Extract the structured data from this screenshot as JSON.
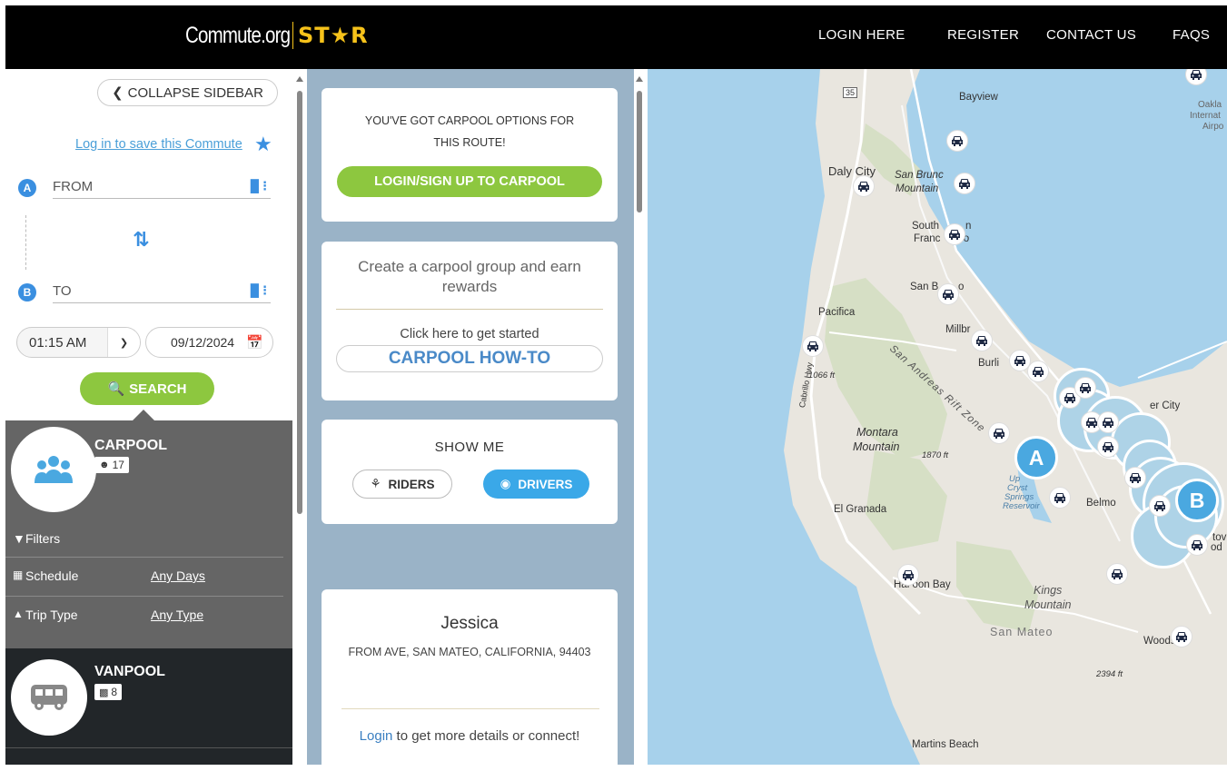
{
  "header": {
    "logo_text": "Commute.org",
    "logo_star": "ST★R",
    "nav": [
      "LOGIN HERE",
      "REGISTER",
      "CONTACT US",
      "FAQS"
    ]
  },
  "sidebar": {
    "collapse_label": "COLLAPSE SIDEBAR",
    "save_link": "Log in to save this Commute",
    "from_pin": "A",
    "to_pin": "B",
    "from_placeholder": "FROM",
    "to_placeholder": "TO",
    "time_value": "01:15 AM",
    "date_value": "09/12/2024",
    "search_label": "SEARCH",
    "carpool": {
      "title": "CARPOOL",
      "count": "17",
      "filters_label": "Filters",
      "schedule_label": "Schedule",
      "schedule_value": "Any Days",
      "trip_type_label": "Trip Type",
      "trip_type_value": "Any Type"
    },
    "vanpool": {
      "title": "VANPOOL",
      "count": "8"
    }
  },
  "middle": {
    "card1": {
      "text": "YOU'VE GOT CARPOOL OPTIONS FOR THIS ROUTE!",
      "button": "LOGIN/SIGN UP TO CARPOOL"
    },
    "card2": {
      "title": "Create a carpool group and earn rewards",
      "subtitle": "Click here to get started",
      "button": "CARPOOL HOW-TO"
    },
    "card3": {
      "title": "SHOW ME",
      "riders": "RIDERS",
      "drivers": "DRIVERS",
      "selected": "DRIVERS"
    },
    "person": {
      "name": "Jessica",
      "address": "FROM AVE, SAN MATEO, CALIFORNIA, 94403",
      "login_link": "Login",
      "login_rest": " to get more details or connect!"
    }
  },
  "map": {
    "labels": {
      "bayview": "Bayview",
      "oakland": "Oakla",
      "internat": "Internat",
      "airpo": "Airpo",
      "daly_city": "Daly City",
      "san_bruno_mtn": "San Brunc",
      "mountain": "Mountain",
      "south_sf": "South",
      "south_n": "n",
      "francisco": "Franc",
      "francisco_end": "co",
      "san_bruno": "San B",
      "san_bruno_end": "o",
      "pacifica": "Pacifica",
      "millbrae": "Millbr",
      "burlingame": "Burli",
      "fault": "San Andreas Rift Zone",
      "elev_1066": "1066 ft",
      "cabrillo": "Cabrillo Hwy",
      "foster_city": "er City",
      "montara": "Montara",
      "montara_mtn": "Mountain",
      "elev_1870": "1870 ft",
      "crystal": "Up",
      "crystal2": "Cryst",
      "crystal3": "Springs",
      "crystal4": "Reservoir",
      "belmont": "Belmo",
      "el_granada": "El Granada",
      "half_moon_bay": "Hal  oon Bay",
      "kings": "Kings",
      "kings_mtn": "Mountain",
      "redwood": "tov",
      "redwood2": "od",
      "san_mateo": "San Mateo",
      "woodside": "Woods",
      "elev_2394": "2394 ft",
      "martins": "Martins Beach",
      "hwy35": "35"
    },
    "pin_a": "A",
    "pin_b": "B"
  },
  "colors": {
    "accent_green": "#8dc73f",
    "accent_blue": "#3a8fe0",
    "star_yellow": "#f6c21a",
    "water": "#a7d1eb",
    "middle_bg": "#9ab3c7"
  }
}
